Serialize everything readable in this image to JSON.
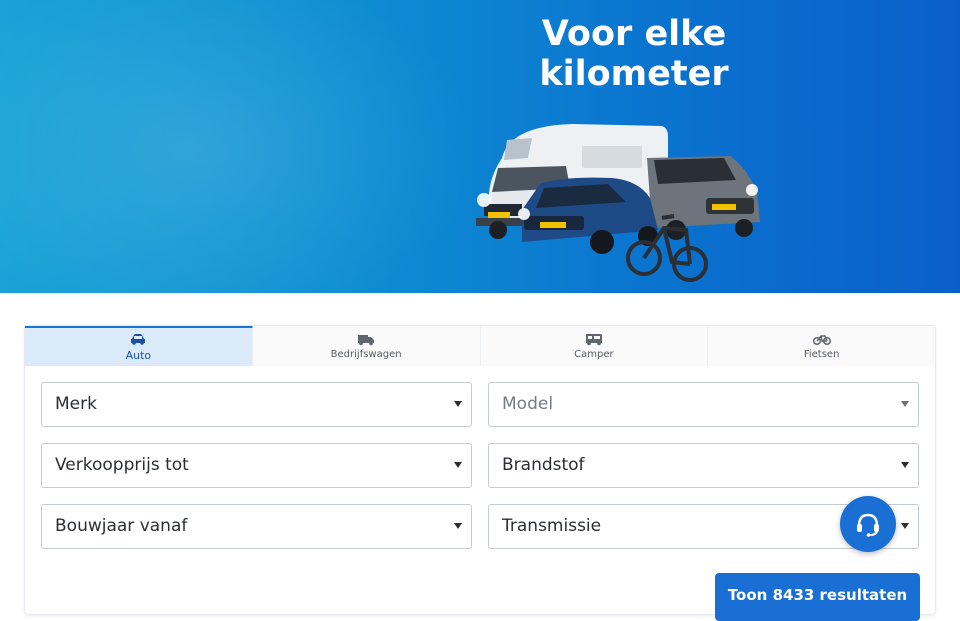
{
  "hero": {
    "title_line1": "Voor elke",
    "title_line2": "kilometer"
  },
  "tabs": [
    {
      "label": "Auto",
      "icon": "car-icon",
      "active": true
    },
    {
      "label": "Bedrijfswagen",
      "icon": "van-icon",
      "active": false
    },
    {
      "label": "Camper",
      "icon": "camper-icon",
      "active": false
    },
    {
      "label": "Fietsen",
      "icon": "bicycle-icon",
      "active": false
    }
  ],
  "filters": {
    "merk": "Merk",
    "model": "Model",
    "verkoopprijs": "Verkoopprijs tot",
    "brandstof": "Brandstof",
    "bouwjaar": "Bouwjaar vanaf",
    "transmissie": "Transmissie"
  },
  "results_button": "Toon 8433 resultaten",
  "colors": {
    "accent": "#1a6fd4",
    "active_tab_bg": "#dbeaf9",
    "hero_start": "#1aa3d6",
    "hero_end": "#0b5fc9"
  },
  "chat": {
    "icon": "headset-icon"
  }
}
